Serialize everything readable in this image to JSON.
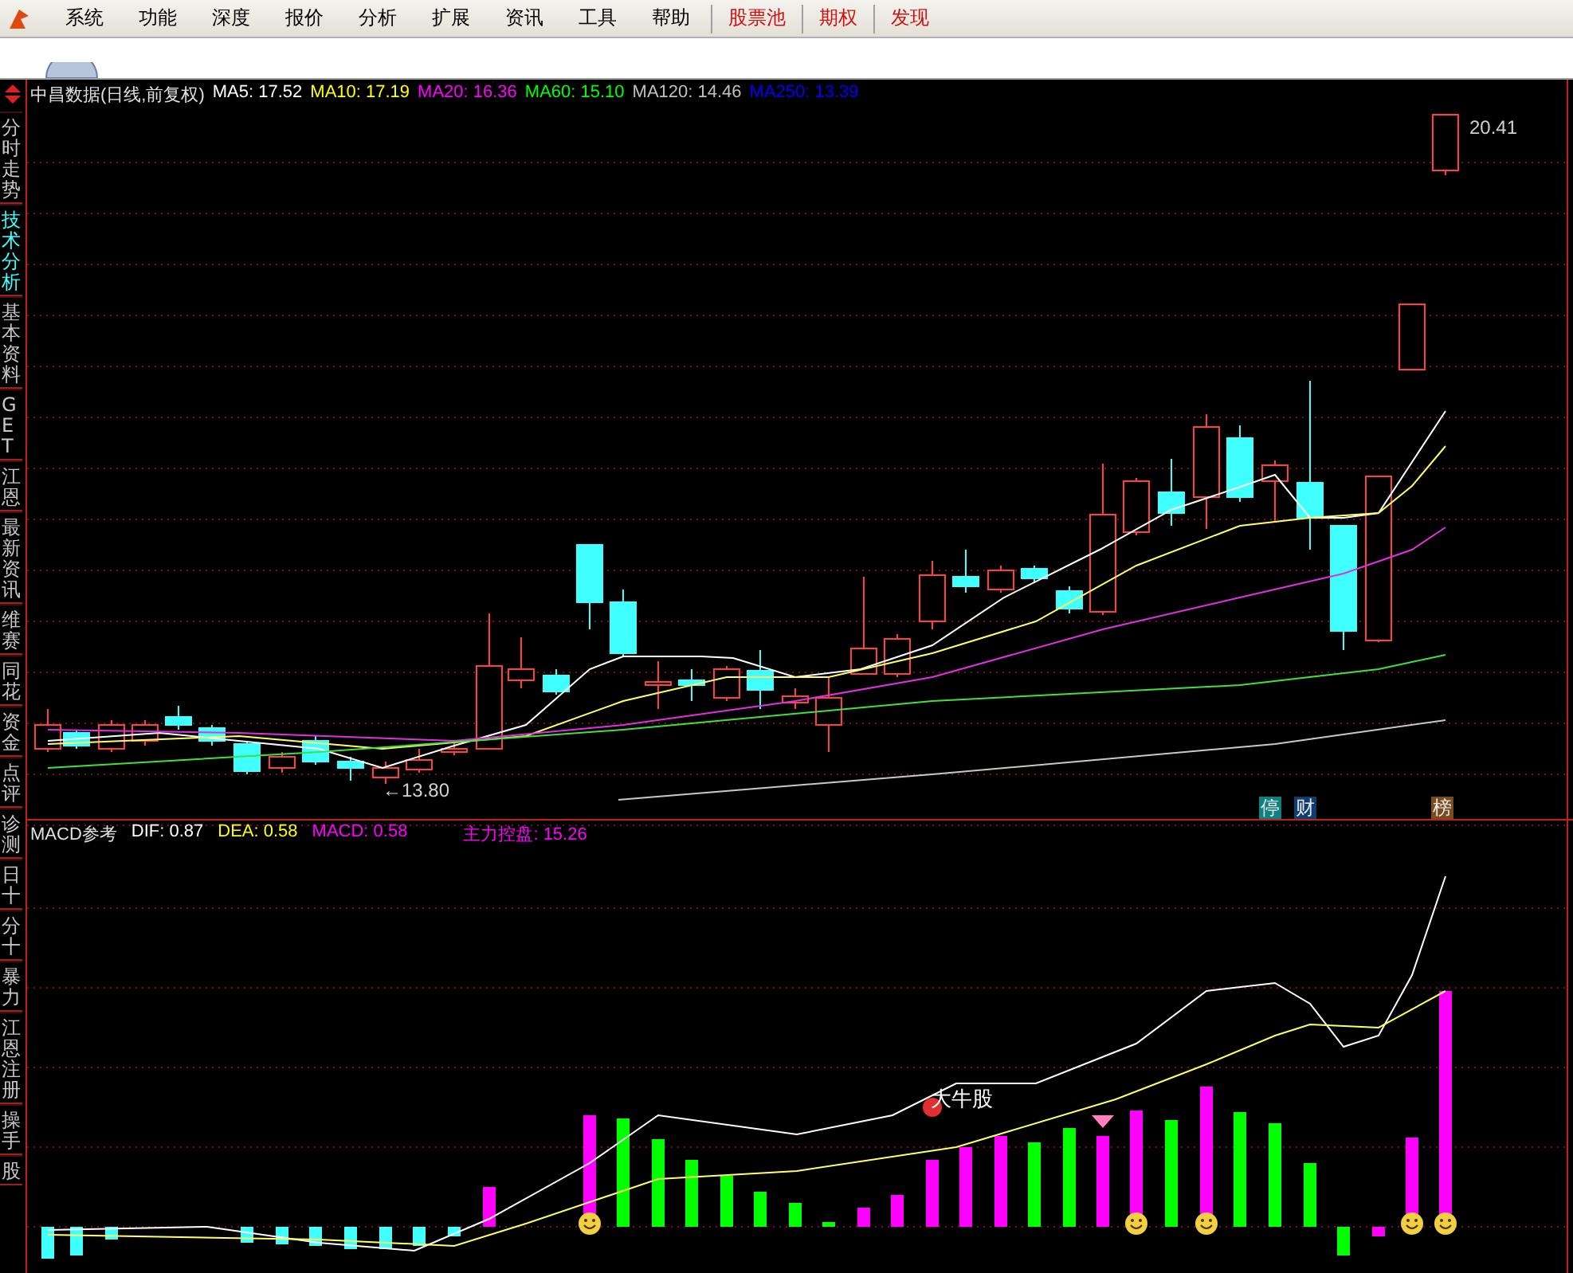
{
  "menu": [
    {
      "label": "系统",
      "kind": "normal"
    },
    {
      "label": "功能",
      "kind": "normal"
    },
    {
      "label": "深度",
      "kind": "normal"
    },
    {
      "label": "报价",
      "kind": "normal"
    },
    {
      "label": "分析",
      "kind": "normal"
    },
    {
      "label": "扩展",
      "kind": "normal"
    },
    {
      "label": "资讯",
      "kind": "normal"
    },
    {
      "label": "工具",
      "kind": "normal"
    },
    {
      "label": "帮助",
      "kind": "normal"
    },
    {
      "label": "股票池",
      "kind": "highlight"
    },
    {
      "label": "期权",
      "kind": "highlight"
    },
    {
      "label": "发现",
      "kind": "highlight"
    }
  ],
  "sidebar": {
    "tabs": [
      {
        "label": "分时走势",
        "selected": false
      },
      {
        "label": "技术分析",
        "selected": true
      },
      {
        "label": "基本资料",
        "selected": false
      },
      {
        "label": "GET",
        "selected": false
      },
      {
        "label": "江恩",
        "selected": false
      },
      {
        "label": "最新资讯",
        "selected": false
      },
      {
        "label": "维赛",
        "selected": false
      },
      {
        "label": "同花",
        "selected": false
      },
      {
        "label": "资金",
        "selected": false
      },
      {
        "label": "点评",
        "selected": false
      },
      {
        "label": "诊测",
        "selected": false
      },
      {
        "label": "日十",
        "selected": false
      },
      {
        "label": "分十",
        "selected": false
      },
      {
        "label": "暴力",
        "selected": false
      },
      {
        "label": "江恩注册",
        "selected": false
      },
      {
        "label": "操手",
        "selected": false
      },
      {
        "label": "股",
        "selected": false
      }
    ]
  },
  "price_chart": {
    "title": "中昌数据(日线,前复权)",
    "legend": [
      {
        "text": "MA5: 17.52",
        "color": "#ffffff"
      },
      {
        "text": "MA10: 17.19",
        "color": "#ffff00"
      },
      {
        "text": "MA20: 16.36",
        "color": "#ff00ff"
      },
      {
        "text": "MA60: 15.10",
        "color": "#00ff00"
      },
      {
        "text": "MA120: 14.46",
        "color": "#c0c0c0"
      },
      {
        "text": "MA250: 13.39",
        "color": "#0000ff"
      }
    ],
    "high_label": "20.41",
    "low_label": "←13.80",
    "markers": [
      {
        "text": "停",
        "color": "#108080"
      },
      {
        "text": "财",
        "color": "#103c6e"
      },
      {
        "text": "榜",
        "color": "#7a4a20"
      }
    ]
  },
  "indicator_chart": {
    "title": "MACD参考",
    "legend": [
      {
        "text": "DIF: 0.87",
        "color": "#ffffff"
      },
      {
        "text": "DEA: 0.58",
        "color": "#ffff00"
      },
      {
        "text": "MACD: 0.58",
        "color": "#ff00ff"
      },
      {
        "text": "主力控盘: 15.26",
        "color": "#ff00ff"
      }
    ],
    "signal_label": "大牛股"
  }
}
